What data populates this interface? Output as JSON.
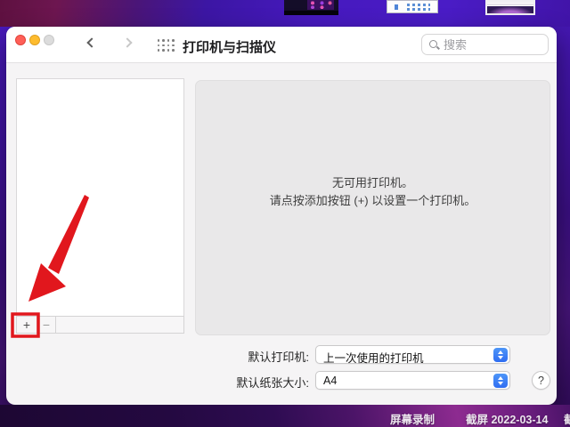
{
  "window": {
    "title": "打印机与扫描仪",
    "titlebar": {
      "traffic_lights": [
        "close",
        "minimize",
        "zoom-disabled"
      ],
      "back_icon": "chevron-left",
      "forward_icon": "chevron-right-disabled",
      "grid_icon": "show-all-grid"
    },
    "search": {
      "placeholder": "搜索",
      "value": ""
    },
    "sidebar": {
      "printer_list_items": [],
      "add_button": "+",
      "remove_button": "−"
    },
    "main_panel": {
      "empty_line1": "无可用打印机。",
      "empty_line2": "请点按添加按钮 (+) 以设置一个打印机。"
    },
    "settings": {
      "default_printer_label": "默认打印机:",
      "default_printer_value": "上一次使用的打印机",
      "default_paper_label": "默认纸张大小:",
      "default_paper_value": "A4",
      "help_button": "?"
    }
  },
  "desktop": {
    "bottom_bar": {
      "screen_recording_label": "屏幕录制",
      "screenshot_label": "截屏 2022-03-14",
      "partial_label_right_edge": "截"
    }
  },
  "annotation": {
    "type": "red-arrow-and-box",
    "target": "add-printer-button",
    "color": "#e1171d"
  },
  "colors": {
    "stepper_blue": "#3b7cf6",
    "annotation_red": "#e1171d",
    "traffic_red": "#ff5f57",
    "traffic_yellow": "#febc2e",
    "traffic_gray": "#dcdcdc",
    "desktop_purple": "#4619be",
    "panel_gray": "#e9e8e9"
  }
}
